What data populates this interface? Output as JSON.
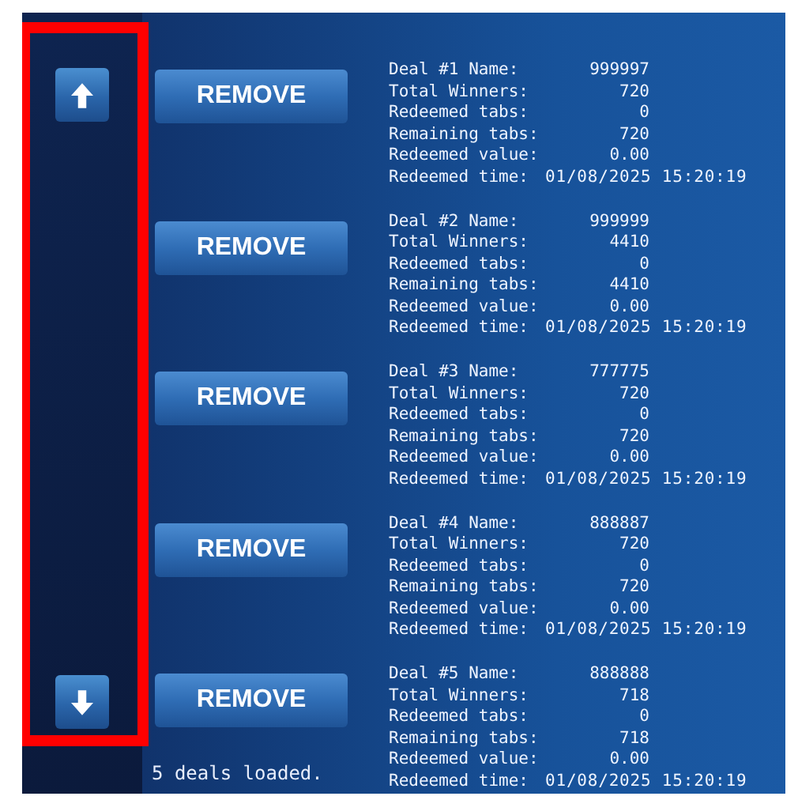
{
  "side_panel": {
    "highlighted": true
  },
  "deals": [
    {
      "remove_button": "REMOVE",
      "fields": [
        {
          "label": "Deal #1 Name:",
          "value": "999997",
          "kind": "number"
        },
        {
          "label": "Total Winners:",
          "value": "720",
          "kind": "number"
        },
        {
          "label": "Redeemed tabs:",
          "value": "0",
          "kind": "number"
        },
        {
          "label": "Remaining tabs:",
          "value": "720",
          "kind": "number"
        },
        {
          "label": "Redeemed value:",
          "value": "0.00",
          "kind": "number"
        },
        {
          "label": "Redeemed time:",
          "value": "01/08/2025 15:20:19",
          "kind": "datetime"
        }
      ]
    },
    {
      "remove_button": "REMOVE",
      "fields": [
        {
          "label": "Deal #2 Name:",
          "value": "999999",
          "kind": "number"
        },
        {
          "label": "Total Winners:",
          "value": "4410",
          "kind": "number"
        },
        {
          "label": "Redeemed tabs:",
          "value": "0",
          "kind": "number"
        },
        {
          "label": "Remaining tabs:",
          "value": "4410",
          "kind": "number"
        },
        {
          "label": "Redeemed value:",
          "value": "0.00",
          "kind": "number"
        },
        {
          "label": "Redeemed time:",
          "value": "01/08/2025 15:20:19",
          "kind": "datetime"
        }
      ]
    },
    {
      "remove_button": "REMOVE",
      "fields": [
        {
          "label": "Deal #3 Name:",
          "value": "777775",
          "kind": "number"
        },
        {
          "label": "Total Winners:",
          "value": "720",
          "kind": "number"
        },
        {
          "label": "Redeemed tabs:",
          "value": "0",
          "kind": "number"
        },
        {
          "label": "Remaining tabs:",
          "value": "720",
          "kind": "number"
        },
        {
          "label": "Redeemed value:",
          "value": "0.00",
          "kind": "number"
        },
        {
          "label": "Redeemed time:",
          "value": "01/08/2025 15:20:19",
          "kind": "datetime"
        }
      ]
    },
    {
      "remove_button": "REMOVE",
      "fields": [
        {
          "label": "Deal #4 Name:",
          "value": "888887",
          "kind": "number"
        },
        {
          "label": "Total Winners:",
          "value": "720",
          "kind": "number"
        },
        {
          "label": "Redeemed tabs:",
          "value": "0",
          "kind": "number"
        },
        {
          "label": "Remaining tabs:",
          "value": "720",
          "kind": "number"
        },
        {
          "label": "Redeemed value:",
          "value": "0.00",
          "kind": "number"
        },
        {
          "label": "Redeemed time:",
          "value": "01/08/2025 15:20:19",
          "kind": "datetime"
        }
      ]
    },
    {
      "remove_button": "REMOVE",
      "fields": [
        {
          "label": "Deal #5 Name:",
          "value": "888888",
          "kind": "number"
        },
        {
          "label": "Total Winners:",
          "value": "718",
          "kind": "number"
        },
        {
          "label": "Redeemed tabs:",
          "value": "0",
          "kind": "number"
        },
        {
          "label": "Remaining tabs:",
          "value": "718",
          "kind": "number"
        },
        {
          "label": "Redeemed value:",
          "value": "0.00",
          "kind": "number"
        },
        {
          "label": "Redeemed time:",
          "value": "01/08/2025 15:20:19",
          "kind": "datetime"
        }
      ]
    }
  ],
  "status": "5 deals loaded."
}
